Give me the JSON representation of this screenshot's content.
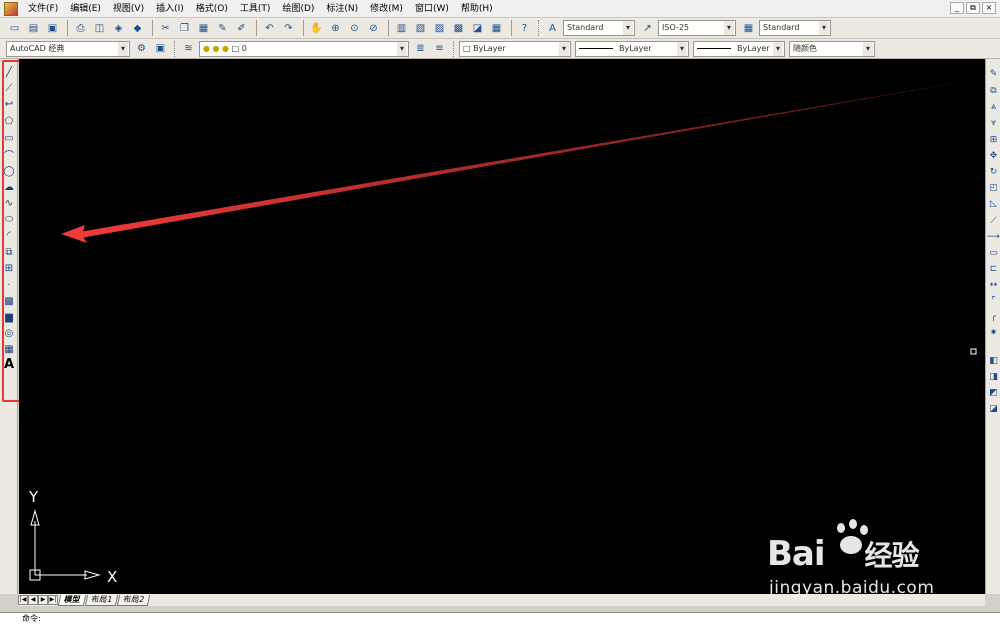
{
  "menubar": {
    "items": [
      "文件(F)",
      "编辑(E)",
      "视图(V)",
      "插入(I)",
      "格式(O)",
      "工具(T)",
      "绘图(D)",
      "标注(N)",
      "修改(M)",
      "窗口(W)",
      "帮助(H)"
    ],
    "window_controls": [
      "_",
      "⧉",
      "×"
    ]
  },
  "toolbar": {
    "text_style": "Standard",
    "dim_style": "ISO-25",
    "table_style": "Standard",
    "workspace": "AutoCAD 经典",
    "layer": "0",
    "color": "ByLayer",
    "linetype": "ByLayer",
    "lineweight": "ByLayer",
    "plot_style": "随颜色"
  },
  "draw_tools": [
    "line-icon",
    "construction-line-icon",
    "polyline-icon",
    "polygon-icon",
    "rectangle-icon",
    "arc-icon",
    "circle-icon",
    "revision-cloud-icon",
    "spline-icon",
    "ellipse-icon",
    "ellipse-arc-icon",
    "insert-block-icon",
    "make-block-icon",
    "point-icon",
    "hatch-icon",
    "gradient-icon",
    "region-icon",
    "table-icon",
    "multiline-text-icon"
  ],
  "text_tool_label": "A",
  "modify_tools": [
    "erase-icon",
    "copy-icon",
    "mirror-icon",
    "offset-icon",
    "array-icon",
    "move-icon",
    "rotate-icon",
    "scale-icon",
    "stretch-icon",
    "trim-icon",
    "extend-icon",
    "break-at-point-icon",
    "break-icon",
    "join-icon",
    "chamfer-icon",
    "fillet-icon",
    "explode-icon"
  ],
  "draw_order_tools": [
    "bring-to-front-icon",
    "send-to-back-icon",
    "bring-above-icon",
    "send-under-icon"
  ],
  "ucs": {
    "x_label": "X",
    "y_label": "Y"
  },
  "layout_tabs": [
    "模型",
    "布局1",
    "布局2"
  ],
  "command_prompt": "命令:",
  "watermark": {
    "brand": "Bai",
    "brand_cn": "经验",
    "url": "jingyan.baidu.com"
  },
  "colors": {
    "canvas_bg": "#000000",
    "highlight": "#e53935",
    "arrow": "#e53935"
  }
}
